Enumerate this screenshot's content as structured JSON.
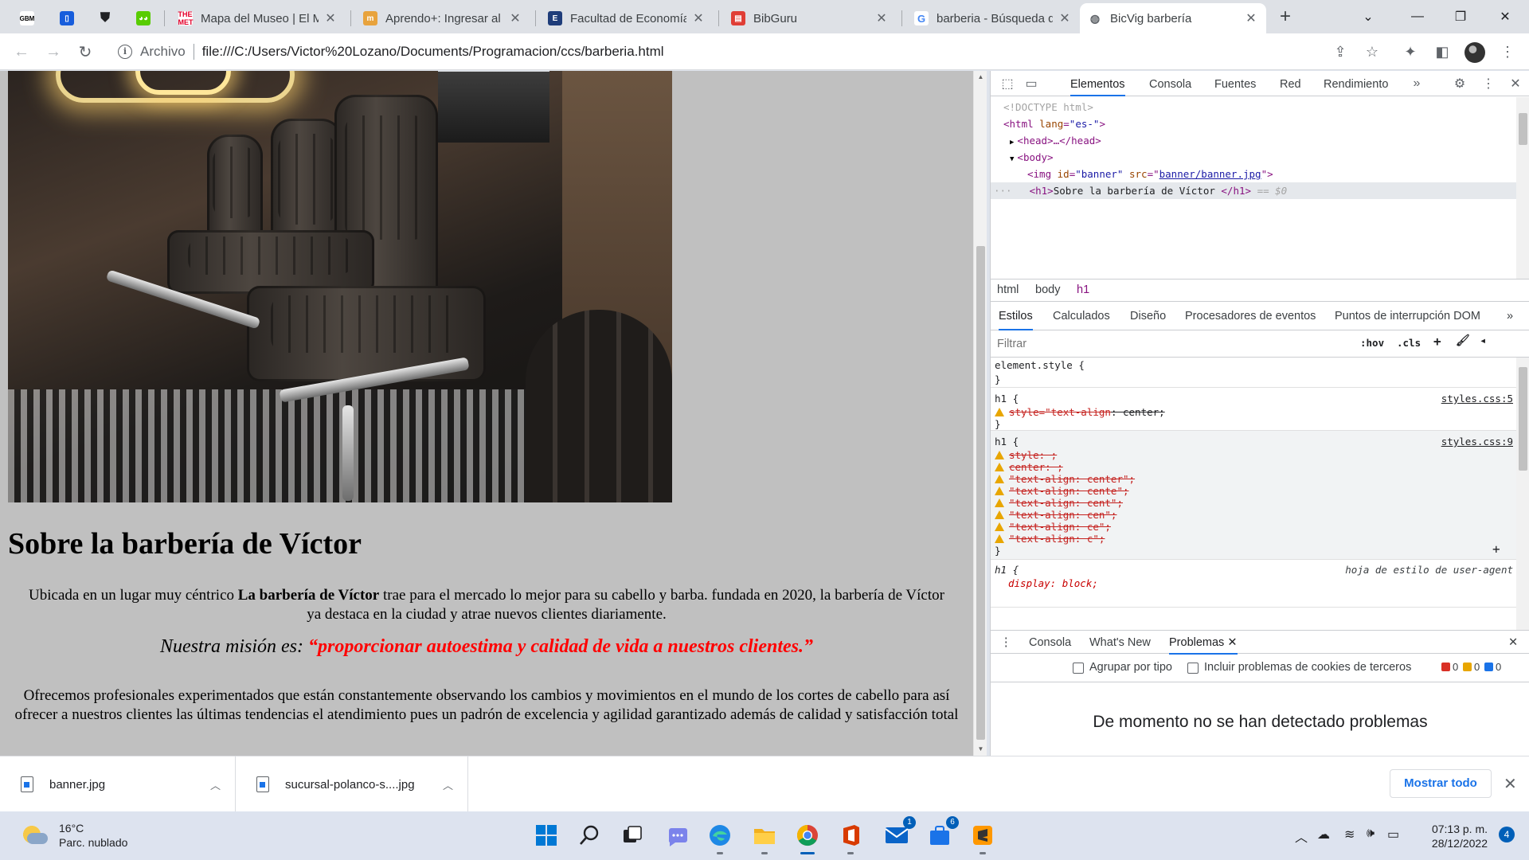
{
  "browser": {
    "tabs": [
      {
        "title": "",
        "favicon": "gbm-icon",
        "color": "#ffffff",
        "pinned": true
      },
      {
        "title": "",
        "favicon": "bitwarden-icon",
        "color": "#175ddc",
        "pinned": true
      },
      {
        "title": "",
        "favicon": "shield-icon",
        "color": "#202124",
        "pinned": true
      },
      {
        "title": "",
        "favicon": "duolingo-icon",
        "color": "#58cc02",
        "pinned": true
      },
      {
        "title": "Mapa del Museo | El M",
        "favicon": "met-icon",
        "color": "#e4002b"
      },
      {
        "title": "Aprendo+: Ingresar al",
        "favicon": "aprendo-icon",
        "color": "#e8a33d"
      },
      {
        "title": "Facultad de Economía",
        "favicon": "facultad-icon",
        "color": "#1f3d7a"
      },
      {
        "title": "BibGuru",
        "favicon": "bibguru-icon",
        "color": "#e03e36"
      },
      {
        "title": "barberia - Búsqueda d",
        "favicon": "google-icon",
        "color": "#4285f4"
      },
      {
        "title": "BicVig barbería",
        "favicon": "globe-icon",
        "color": "#5f6368",
        "active": true
      }
    ],
    "address": {
      "scheme_label": "Archivo",
      "url": "file:///C:/Users/Victor%20Lozano/Documents/Programacion/ccs/barberia.html"
    }
  },
  "page": {
    "title": "Sobre la barbería de Víctor",
    "p1_before": "Ubicada en un lugar muy céntrico ",
    "p1_bold": "La barbería de Víctor",
    "p1_after": " trae para el mercado lo mejor para su cabello y barba. fundada en 2020, la barbería de Víctor ya destaca en la ciudad y atrae nuevos clientes diariamente.",
    "mission_label": "Nuestra misión es: ",
    "mission_quote": "“proporcionar autoestima y calidad de vida a nuestros clientes.”",
    "p3": "Ofrecemos profesionales experimentados que están constantemente observando los cambios y movimientos en el mundo de los cortes de cabello para así ofrecer a nuestros clientes las últimas tendencias el atendimiento pues un padrón de excelencia y agilidad garantizado además de calidad y satisfacción total"
  },
  "devtools": {
    "tabs": [
      "Elementos",
      "Consola",
      "Fuentes",
      "Red",
      "Rendimiento"
    ],
    "more": "»",
    "tree": {
      "doctype": "<!DOCTYPE html>",
      "html_open": "<html ",
      "html_attr": "lang",
      "html_val": "\"es-\"",
      "head": "<head>…</head>",
      "body": "<body>",
      "img_tag": "<img ",
      "img_attr1": "id",
      "img_val1": "\"banner\"",
      "img_attr2": "src",
      "img_val2": "banner/banner.jpg",
      "h1_open": "<h1>",
      "h1_text": "Sobre la barbería de Víctor ",
      "h1_close": "</h1>",
      "h1_eq": " == $0",
      "ellipsis": "···"
    },
    "breadcrumbs": [
      "html",
      "body",
      "h1"
    ],
    "style_tabs": [
      "Estilos",
      "Calculados",
      "Diseño",
      "Procesadores de eventos",
      "Puntos de interrupción DOM"
    ],
    "filter_placeholder": "Filtrar",
    "hov": ":hov",
    "cls": ".cls",
    "rules": {
      "element_style": "element.style {",
      "close": "}",
      "r1_selector": "h1 {",
      "r1_source": "styles.css:5",
      "r1_prop": "style=\"text-align",
      "r1_val": ": center;",
      "r2_selector": "h1 {",
      "r2_source": "styles.css:9",
      "r2_lines": [
        "style: ;",
        "center: ;",
        "\"text-align: center\";",
        "\"text-align: cente\";",
        "\"text-align: cent\";",
        "\"text-align: cen\";",
        "\"text-align: ce\";",
        "\"text-align: c\";"
      ],
      "r3_selector": "h1 {",
      "r3_source": "hoja de estilo de user-agent",
      "r3_prop": "display: block;"
    },
    "drawer_tabs": [
      "Consola",
      "What's New",
      "Problemas"
    ],
    "group_by_type": "Agrupar por tipo",
    "third_party": "Incluir problemas de cookies de terceros",
    "counts": {
      "errors": "0",
      "warnings": "0",
      "info": "0"
    },
    "no_problems": "De momento no se han detectado problemas"
  },
  "downloads": {
    "items": [
      "banner.jpg",
      "sucursal-polanco-s....jpg"
    ],
    "show_all": "Mostrar todo"
  },
  "taskbar": {
    "temp": "16°C",
    "weather": "Parc. nublado",
    "time": "07:13 p. m.",
    "date": "28/12/2022",
    "notifications": "4",
    "mail_badge": "1",
    "teams_badge": "6"
  }
}
